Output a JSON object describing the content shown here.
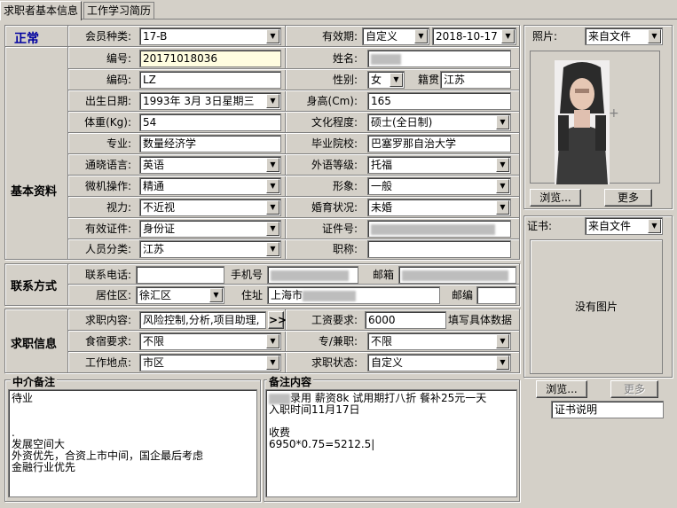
{
  "tabs": [
    "求职者基本信息",
    "工作学习简历"
  ],
  "status": "正常",
  "sections": {
    "basic": "基本资料",
    "contact": "联系方式",
    "job": "求职信息",
    "agent_note": "中介备注",
    "remark": "备注内容"
  },
  "labels": {
    "member_type": "会员种类:",
    "validity": "有效期:",
    "number": "编号:",
    "name": "姓名:",
    "code": "编码:",
    "gender": "性别:",
    "origin": "籍贯",
    "birth": "出生日期:",
    "height": "身高(Cm):",
    "weight": "体重(Kg):",
    "education": "文化程度:",
    "major": "专业:",
    "school": "毕业院校:",
    "language": "通晓语言:",
    "foreign_level": "外语等级:",
    "computer": "微机操作:",
    "image": "形象:",
    "vision": "视力:",
    "marital": "婚育状况:",
    "certificate": "有效证件:",
    "cert_no": "证件号:",
    "person_type": "人员分类:",
    "title": "职称:",
    "phone": "联系电话:",
    "mobile": "手机号",
    "email": "邮箱",
    "area": "居住区:",
    "address": "住址",
    "postcode": "邮编",
    "job_content": "求职内容:",
    "salary": "工资要求:",
    "board": "食宿要求:",
    "parttime": "专/兼职:",
    "location": "工作地点:",
    "job_status": "求职状态:"
  },
  "values": {
    "member_type": "17-B",
    "validity_type": "自定义",
    "validity_date": "2018-10-17",
    "number": "20171018036",
    "name": "",
    "code": "LZ",
    "gender": "女",
    "origin": "江苏",
    "birth": "1993年 3月 3日星期三",
    "height": "165",
    "weight": "54",
    "education": "硕士(全日制)",
    "major": "数量经济学",
    "school": "巴塞罗那自治大学",
    "language": "英语",
    "foreign_level": "托福",
    "computer": "精通",
    "image": "一般",
    "vision": "不近视",
    "marital": "未婚",
    "certificate": "身份证",
    "cert_no": "",
    "person_type": "江苏",
    "title": "",
    "phone": "",
    "mobile": "",
    "email": "",
    "area": "徐汇区",
    "address_prefix": "上海市",
    "postcode": "",
    "job_content": "风险控制,分析,项目助理,",
    "job_more": ">>",
    "salary": "6000",
    "salary_hint": "填写具体数据",
    "board": "不限",
    "parttime": "不限",
    "location": "市区",
    "job_status": "自定义"
  },
  "agent_note": "待业\n\n\n.\n发展空间大\n外资优先，合资上市中间，国企最后考虑\n金融行业优先",
  "remark": {
    "line1": "录用  薪资8k 试用期打八折  餐补25元一天",
    "rest": "入职时间11月17日\n\n收费\n6950*0.75=5212.5|"
  },
  "photo": {
    "label": "照片:",
    "source": "来自文件",
    "browse": "浏览...",
    "more": "更多"
  },
  "cert": {
    "label": "证书:",
    "source": "来自文件",
    "empty": "没有图片",
    "browse": "浏览...",
    "more": "更多",
    "desc": "证书说明"
  }
}
